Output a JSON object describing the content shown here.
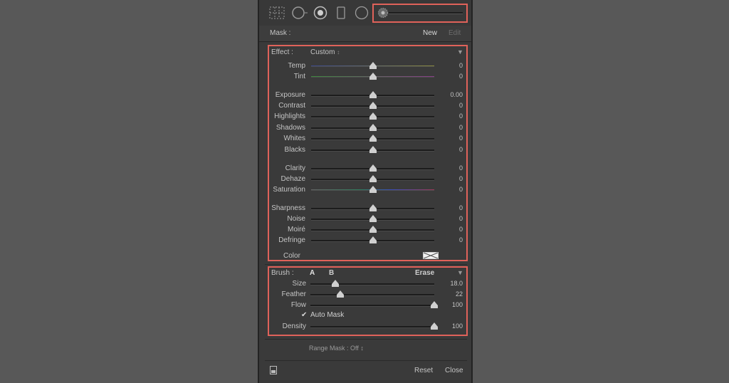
{
  "toolbar": {
    "icons": [
      "grid-overlay-icon",
      "graduated-filter-icon",
      "radial-filter-icon",
      "red-eye-icon",
      "spot-removal-icon",
      "adjustment-brush-icon"
    ]
  },
  "mask": {
    "label": "Mask :",
    "new_label": "New",
    "edit_label": "Edit"
  },
  "effect": {
    "label": "Effect :",
    "preset": "Custom",
    "preset_arrow": "↕",
    "collapse_arrow": "▼",
    "sliders": [
      {
        "label": "Temp",
        "value": "0",
        "level": 0.5
      },
      {
        "label": "Tint",
        "value": "0",
        "level": 0.5
      },
      {
        "label": "Exposure",
        "value": "0.00",
        "level": 0.5
      },
      {
        "label": "Contrast",
        "value": "0",
        "level": 0.5
      },
      {
        "label": "Highlights",
        "value": "0",
        "level": 0.5
      },
      {
        "label": "Shadows",
        "value": "0",
        "level": 0.5
      },
      {
        "label": "Whites",
        "value": "0",
        "level": 0.5
      },
      {
        "label": "Blacks",
        "value": "0",
        "level": 0.5
      },
      {
        "label": "Clarity",
        "value": "0",
        "level": 0.5
      },
      {
        "label": "Dehaze",
        "value": "0",
        "level": 0.5
      },
      {
        "label": "Saturation",
        "value": "0",
        "level": 0.5
      },
      {
        "label": "Sharpness",
        "value": "0",
        "level": 0.5
      },
      {
        "label": "Noise",
        "value": "0",
        "level": 0.5
      },
      {
        "label": "Moiré",
        "value": "0",
        "level": 0.5
      },
      {
        "label": "Defringe",
        "value": "0",
        "level": 0.5
      }
    ],
    "color_label": "Color"
  },
  "brush": {
    "label": "Brush :",
    "a_label": "A",
    "b_label": "B",
    "erase_label": "Erase",
    "collapse_arrow": "▼",
    "sliders": [
      {
        "label": "Size",
        "value": "18.0",
        "level": 0.2
      },
      {
        "label": "Feather",
        "value": "22",
        "level": 0.24
      },
      {
        "label": "Flow",
        "value": "100",
        "level": 1.0
      }
    ],
    "auto_mask_check": "✔",
    "auto_mask_label": "Auto Mask",
    "density": {
      "label": "Density",
      "value": "100",
      "level": 1.0
    }
  },
  "range_mask": {
    "label": "Range Mask : Off",
    "arrow": "↕"
  },
  "footer": {
    "reset_label": "Reset",
    "close_label": "Close"
  },
  "colors": {
    "highlight": "#e0625a",
    "panel": "#3a3a3a",
    "background": "#585858"
  }
}
